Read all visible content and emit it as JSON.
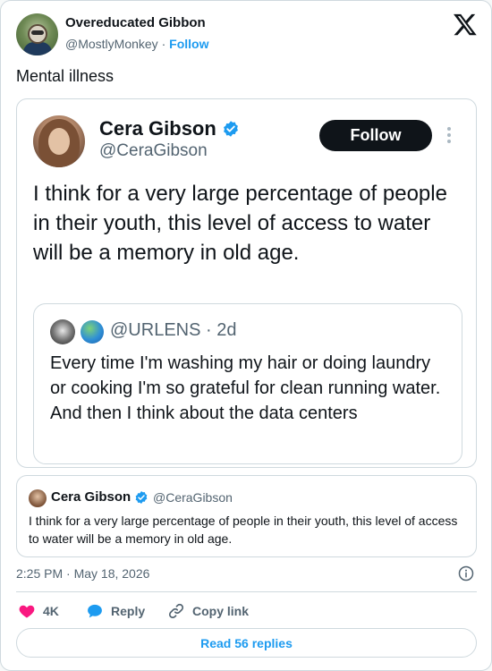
{
  "tweet": {
    "author_name": "Overeducated Gibbon",
    "author_handle": "@MostlyMonkey",
    "separator": "·",
    "follow_label": "Follow",
    "text": "Mental illness",
    "timestamp": "2:25 PM · May 18, 2026"
  },
  "embedded": {
    "name": "Cera Gibson",
    "handle": "@CeraGibson",
    "follow_label": "Follow",
    "text": "I think for a very large percentage of people in their youth, this level of access to water will be a memory in old age.",
    "quoted": {
      "handle_time": "@URLENS · 2d",
      "text": "Every time I'm washing my hair or doing laundry or cooking I'm so grateful for clean running water. And then I think about the data centers"
    }
  },
  "quote_card": {
    "name": "Cera Gibson",
    "handle": "@CeraGibson",
    "text": "I think for a very large percentage of people in their youth, this level of access to water will be a memory in old age."
  },
  "actions": {
    "likes": "4K",
    "reply_label": "Reply",
    "copy_label": "Copy link"
  },
  "read_replies_label": "Read 56 replies",
  "colors": {
    "accent": "#1d9bf0",
    "like": "#f91880",
    "text": "#0f1419",
    "muted": "#536471",
    "border": "#cfd9de"
  }
}
